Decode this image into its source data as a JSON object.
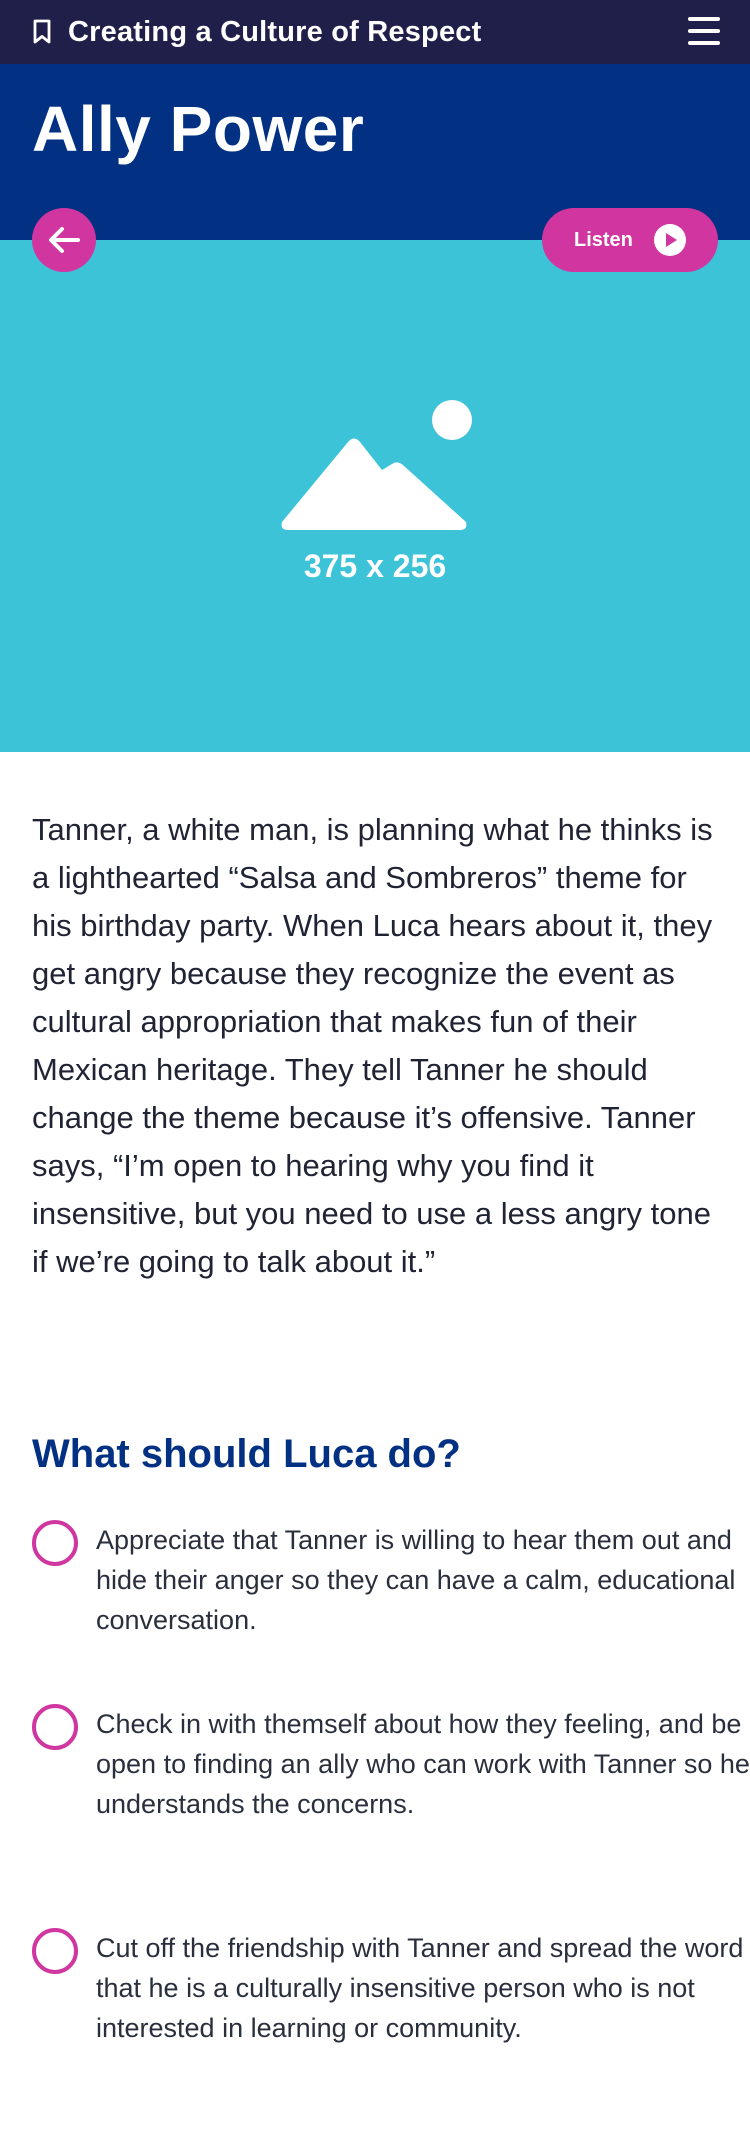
{
  "topbar": {
    "course_title": "Creating a Culture of Respect",
    "bookmark_icon": "bookmark-icon",
    "menu_icon": "hamburger-menu-icon"
  },
  "header": {
    "page_title": "Ally Power"
  },
  "hero": {
    "placeholder_icon": "image-placeholder-icon",
    "placeholder_size": "375 x 256",
    "background_color": "#3cc3d8"
  },
  "controls": {
    "back_icon": "arrow-left-icon",
    "listen_label": "Listen",
    "play_icon": "play-icon",
    "accent_color": "#d1359f"
  },
  "story": {
    "text": "Tanner, a white man, is planning what he thinks is a lighthearted “Salsa and Sombreros” theme for his birthday party. When Luca hears about it, they get angry because they recognize the event as cultural appropriation that makes fun of their Mexican heritage. They tell Tanner he should change the theme because it’s offensive. Tanner says, “I’m open to hearing why you find it insensitive, but you need to use a less angry tone if we’re going to talk about it.”"
  },
  "quiz": {
    "question": "What should Luca do?",
    "options": [
      {
        "label": "Appreciate that Tanner is willing to hear them out and hide their anger so they can have a calm, educational conversation."
      },
      {
        "label": "Check in with themself about how they feeling, and be open to finding an ally who can work with Tanner so he understands the concerns."
      },
      {
        "label": "Cut off the friendship with Tanner and spread the word that he is a culturally insensitive person who is not interested in learning or community."
      }
    ]
  },
  "colors": {
    "topbar": "#1f1f4a",
    "header": "#023083",
    "heading_text": "#023083"
  }
}
